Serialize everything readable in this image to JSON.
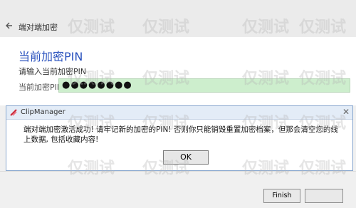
{
  "topbar": {
    "title": "端对端加密"
  },
  "content": {
    "section_title": "当前加密PIN",
    "prompt": "请输入当前加密PIN",
    "pin_label": "当前加密PIN",
    "pin_value": "●●●●●●●●"
  },
  "dialog": {
    "title": "ClipManager",
    "message": "端对端加密激活成功! 请牢记新的加密的PIN! 否则你只能销毁重置加密档案，但那会清空您的线上数据, 包括收藏内容!",
    "ok_label": "OK"
  },
  "footer": {
    "finish_label": "Finish"
  },
  "watermark": {
    "text": "仅测试"
  },
  "colors": {
    "accent_title": "#2a52be",
    "pin_field": "#cdeecd"
  }
}
